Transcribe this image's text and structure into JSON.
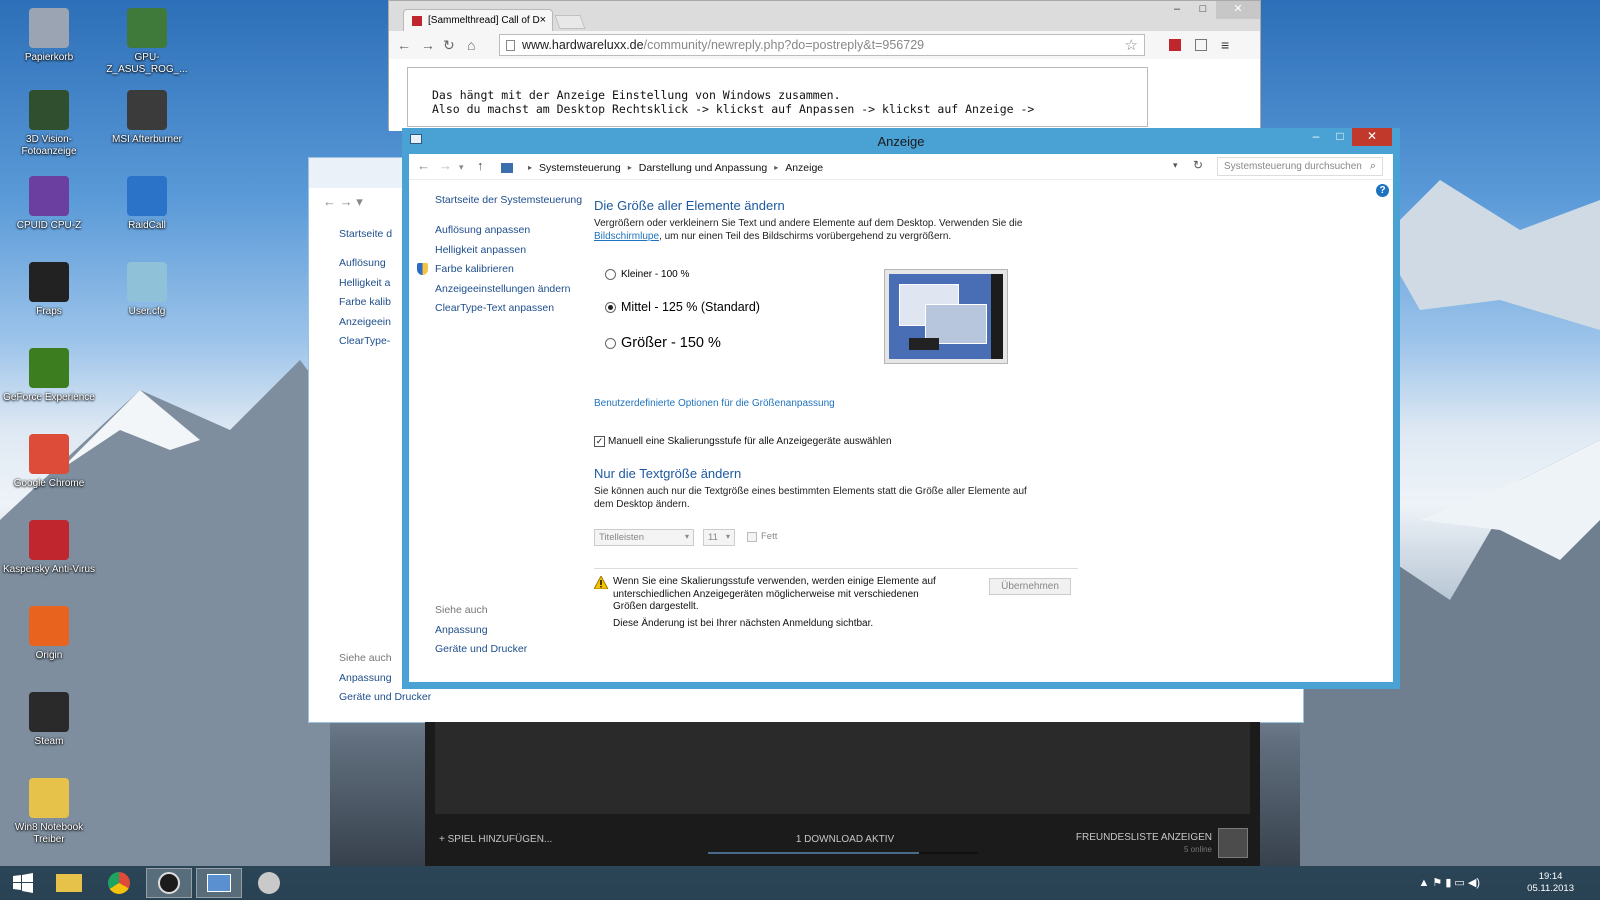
{
  "desktop": {
    "icons": [
      {
        "label": "Papierkorb",
        "icon": "recycle-bin-icon",
        "color": "#9aa4b2"
      },
      {
        "label": "GPU-Z_ASUS_ROG_...",
        "icon": "gpu-z-icon",
        "color": "#3f7a3a"
      },
      {
        "label": "3D Vision-Fotoanzeige",
        "icon": "3d-vision-icon",
        "color": "#2f4f2f"
      },
      {
        "label": "MSI Afterburner",
        "icon": "msi-afterburner-icon",
        "color": "#3b3b3b"
      },
      {
        "label": "CPUID CPU-Z",
        "icon": "cpu-z-icon",
        "color": "#6a3fa0"
      },
      {
        "label": "RaidCall",
        "icon": "raidcall-icon",
        "color": "#2a73c8"
      },
      {
        "label": "Fraps",
        "icon": "fraps-icon",
        "color": "#222222"
      },
      {
        "label": "User.cfg",
        "icon": "cfg-file-icon",
        "color": "#8fc2d8"
      },
      {
        "label": "GeForce Experience",
        "icon": "geforce-icon",
        "color": "#3b7d1f"
      },
      {
        "label": "Google Chrome",
        "icon": "chrome-icon",
        "color": "#dd4b39"
      },
      {
        "label": "Kaspersky Anti-Virus",
        "icon": "kaspersky-icon",
        "color": "#c0262e"
      },
      {
        "label": "Origin",
        "icon": "origin-icon",
        "color": "#e8641e"
      },
      {
        "label": "Steam",
        "icon": "steam-icon",
        "color": "#2a2a2a"
      },
      {
        "label": "Win8 Notebook Treiber",
        "icon": "folder-icon",
        "color": "#e6c24a"
      }
    ]
  },
  "chrome": {
    "tab_title": "[Sammelthread] Call of D",
    "tab_close": "×",
    "url_host": "www.hardwareluxx.de",
    "url_path": "/community/newreply.php?do=postreply&t=956729",
    "min": "–",
    "max": "□",
    "close": "✕",
    "back": "←",
    "forward": "→",
    "reload": "↻",
    "home": "⌂",
    "star": "☆",
    "menu": "≡",
    "editor_text": "Das hängt mit der Anzeige Einstellung von Windows zusammen.\nAlso du machst am Desktop Rechtsklick -> klickst auf Anpassen -> klickst auf Anzeige ->"
  },
  "bg_window": {
    "nav": "←  →  ▾",
    "links": [
      "Startseite d",
      "Auflösung",
      "Helligkeit a",
      "Farbe kalib",
      "Anzeigeein",
      "ClearType-"
    ],
    "see_also": "Siehe auch",
    "see_links": [
      "Anpassung",
      "Geräte und Drucker"
    ]
  },
  "steam": {
    "add_game": "+   SPIEL HINZUFÜGEN...",
    "download": "1 DOWNLOAD AKTIV",
    "download_progress": 0.78,
    "friends": "FREUNDESLISTE ANZEIGEN",
    "online": "5 online"
  },
  "anzeige": {
    "title": "Anzeige",
    "min": "–",
    "max": "□",
    "close": "✕",
    "nav_back": "←",
    "nav_forward": "→",
    "nav_down": "▾",
    "nav_up": "↑",
    "breadcrumb": [
      "Systemsteuerung",
      "Darstellung und Anpassung",
      "Anzeige"
    ],
    "crumb_sep": "▸",
    "address_dropdown": "▾",
    "refresh": "↻",
    "search_placeholder": "Systemsteuerung durchsuchen",
    "search_icon": "⌕",
    "help": "?",
    "left_home": "Startseite der Systemsteuerung",
    "left_links": [
      "Auflösung anpassen",
      "Helligkeit anpassen",
      "Farbe kalibrieren",
      "Anzeigeeinstellungen ändern",
      "ClearType-Text anpassen"
    ],
    "heading": "Die Größe aller Elemente ändern",
    "desc_before": "Vergrößern oder verkleinern Sie Text und andere Elemente auf dem Desktop. Verwenden Sie die ",
    "desc_link": "Bildschirmlupe",
    "desc_after": ", um nur einen Teil des Bildschirms vorübergehend zu vergrößern.",
    "options": [
      {
        "label": "Kleiner - 100 %",
        "selected": false
      },
      {
        "label": "Mittel - 125 % (Standard)",
        "selected": true
      },
      {
        "label": "Größer - 150 %",
        "selected": false
      }
    ],
    "custom_link": "Benutzerdefinierte Optionen für die Größenanpassung",
    "checkbox_label": "Manuell eine Skalierungsstufe für alle Anzeigegeräte auswählen",
    "checkbox_checked": true,
    "checkbox_mark": "✓",
    "heading2": "Nur die Textgröße ändern",
    "desc2": "Sie können auch nur die Textgröße eines bestimmten Elements statt die Größe aller Elemente auf dem Desktop ändern.",
    "element_select": "Titelleisten",
    "size_select": "11",
    "select_arrow": "▾",
    "bold_label": "Fett",
    "warning": "Wenn Sie eine Skalierungsstufe verwenden, werden einige Elemente auf unterschiedlichen Anzeigegeräten möglicherweise mit verschiedenen Größen dargestellt.",
    "warning2": "Diese Änderung ist bei Ihrer nächsten Anmeldung sichtbar.",
    "apply": "Übernehmen",
    "see_also": "Siehe auch",
    "see_links": [
      "Anpassung",
      "Geräte und Drucker"
    ]
  },
  "taskbar": {
    "tray_icons": "▲  ⚑  ▮  ▭  ◀)",
    "time": "19:14",
    "date": "05.11.2013"
  },
  "colors": {
    "accent": "#4aa1d3",
    "link": "#1e73be",
    "heading": "#1e5aa0"
  }
}
